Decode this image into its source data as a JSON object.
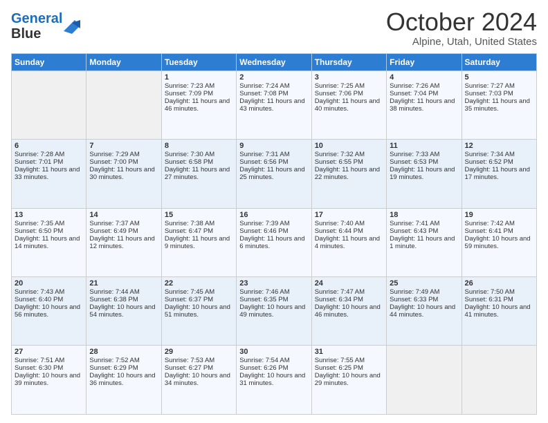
{
  "header": {
    "month_title": "October 2024",
    "location": "Alpine, Utah, United States"
  },
  "table": {
    "headers": [
      "Sunday",
      "Monday",
      "Tuesday",
      "Wednesday",
      "Thursday",
      "Friday",
      "Saturday"
    ]
  },
  "rows": [
    [
      {
        "day": "",
        "sunrise": "",
        "sunset": "",
        "daylight": "",
        "empty": true
      },
      {
        "day": "",
        "sunrise": "",
        "sunset": "",
        "daylight": "",
        "empty": true
      },
      {
        "day": "1",
        "sunrise": "Sunrise: 7:23 AM",
        "sunset": "Sunset: 7:09 PM",
        "daylight": "Daylight: 11 hours and 46 minutes."
      },
      {
        "day": "2",
        "sunrise": "Sunrise: 7:24 AM",
        "sunset": "Sunset: 7:08 PM",
        "daylight": "Daylight: 11 hours and 43 minutes."
      },
      {
        "day": "3",
        "sunrise": "Sunrise: 7:25 AM",
        "sunset": "Sunset: 7:06 PM",
        "daylight": "Daylight: 11 hours and 40 minutes."
      },
      {
        "day": "4",
        "sunrise": "Sunrise: 7:26 AM",
        "sunset": "Sunset: 7:04 PM",
        "daylight": "Daylight: 11 hours and 38 minutes."
      },
      {
        "day": "5",
        "sunrise": "Sunrise: 7:27 AM",
        "sunset": "Sunset: 7:03 PM",
        "daylight": "Daylight: 11 hours and 35 minutes."
      }
    ],
    [
      {
        "day": "6",
        "sunrise": "Sunrise: 7:28 AM",
        "sunset": "Sunset: 7:01 PM",
        "daylight": "Daylight: 11 hours and 33 minutes."
      },
      {
        "day": "7",
        "sunrise": "Sunrise: 7:29 AM",
        "sunset": "Sunset: 7:00 PM",
        "daylight": "Daylight: 11 hours and 30 minutes."
      },
      {
        "day": "8",
        "sunrise": "Sunrise: 7:30 AM",
        "sunset": "Sunset: 6:58 PM",
        "daylight": "Daylight: 11 hours and 27 minutes."
      },
      {
        "day": "9",
        "sunrise": "Sunrise: 7:31 AM",
        "sunset": "Sunset: 6:56 PM",
        "daylight": "Daylight: 11 hours and 25 minutes."
      },
      {
        "day": "10",
        "sunrise": "Sunrise: 7:32 AM",
        "sunset": "Sunset: 6:55 PM",
        "daylight": "Daylight: 11 hours and 22 minutes."
      },
      {
        "day": "11",
        "sunrise": "Sunrise: 7:33 AM",
        "sunset": "Sunset: 6:53 PM",
        "daylight": "Daylight: 11 hours and 19 minutes."
      },
      {
        "day": "12",
        "sunrise": "Sunrise: 7:34 AM",
        "sunset": "Sunset: 6:52 PM",
        "daylight": "Daylight: 11 hours and 17 minutes."
      }
    ],
    [
      {
        "day": "13",
        "sunrise": "Sunrise: 7:35 AM",
        "sunset": "Sunset: 6:50 PM",
        "daylight": "Daylight: 11 hours and 14 minutes."
      },
      {
        "day": "14",
        "sunrise": "Sunrise: 7:37 AM",
        "sunset": "Sunset: 6:49 PM",
        "daylight": "Daylight: 11 hours and 12 minutes."
      },
      {
        "day": "15",
        "sunrise": "Sunrise: 7:38 AM",
        "sunset": "Sunset: 6:47 PM",
        "daylight": "Daylight: 11 hours and 9 minutes."
      },
      {
        "day": "16",
        "sunrise": "Sunrise: 7:39 AM",
        "sunset": "Sunset: 6:46 PM",
        "daylight": "Daylight: 11 hours and 6 minutes."
      },
      {
        "day": "17",
        "sunrise": "Sunrise: 7:40 AM",
        "sunset": "Sunset: 6:44 PM",
        "daylight": "Daylight: 11 hours and 4 minutes."
      },
      {
        "day": "18",
        "sunrise": "Sunrise: 7:41 AM",
        "sunset": "Sunset: 6:43 PM",
        "daylight": "Daylight: 11 hours and 1 minute."
      },
      {
        "day": "19",
        "sunrise": "Sunrise: 7:42 AM",
        "sunset": "Sunset: 6:41 PM",
        "daylight": "Daylight: 10 hours and 59 minutes."
      }
    ],
    [
      {
        "day": "20",
        "sunrise": "Sunrise: 7:43 AM",
        "sunset": "Sunset: 6:40 PM",
        "daylight": "Daylight: 10 hours and 56 minutes."
      },
      {
        "day": "21",
        "sunrise": "Sunrise: 7:44 AM",
        "sunset": "Sunset: 6:38 PM",
        "daylight": "Daylight: 10 hours and 54 minutes."
      },
      {
        "day": "22",
        "sunrise": "Sunrise: 7:45 AM",
        "sunset": "Sunset: 6:37 PM",
        "daylight": "Daylight: 10 hours and 51 minutes."
      },
      {
        "day": "23",
        "sunrise": "Sunrise: 7:46 AM",
        "sunset": "Sunset: 6:35 PM",
        "daylight": "Daylight: 10 hours and 49 minutes."
      },
      {
        "day": "24",
        "sunrise": "Sunrise: 7:47 AM",
        "sunset": "Sunset: 6:34 PM",
        "daylight": "Daylight: 10 hours and 46 minutes."
      },
      {
        "day": "25",
        "sunrise": "Sunrise: 7:49 AM",
        "sunset": "Sunset: 6:33 PM",
        "daylight": "Daylight: 10 hours and 44 minutes."
      },
      {
        "day": "26",
        "sunrise": "Sunrise: 7:50 AM",
        "sunset": "Sunset: 6:31 PM",
        "daylight": "Daylight: 10 hours and 41 minutes."
      }
    ],
    [
      {
        "day": "27",
        "sunrise": "Sunrise: 7:51 AM",
        "sunset": "Sunset: 6:30 PM",
        "daylight": "Daylight: 10 hours and 39 minutes."
      },
      {
        "day": "28",
        "sunrise": "Sunrise: 7:52 AM",
        "sunset": "Sunset: 6:29 PM",
        "daylight": "Daylight: 10 hours and 36 minutes."
      },
      {
        "day": "29",
        "sunrise": "Sunrise: 7:53 AM",
        "sunset": "Sunset: 6:27 PM",
        "daylight": "Daylight: 10 hours and 34 minutes."
      },
      {
        "day": "30",
        "sunrise": "Sunrise: 7:54 AM",
        "sunset": "Sunset: 6:26 PM",
        "daylight": "Daylight: 10 hours and 31 minutes."
      },
      {
        "day": "31",
        "sunrise": "Sunrise: 7:55 AM",
        "sunset": "Sunset: 6:25 PM",
        "daylight": "Daylight: 10 hours and 29 minutes."
      },
      {
        "day": "",
        "sunrise": "",
        "sunset": "",
        "daylight": "",
        "empty": true
      },
      {
        "day": "",
        "sunrise": "",
        "sunset": "",
        "daylight": "",
        "empty": true
      }
    ]
  ]
}
